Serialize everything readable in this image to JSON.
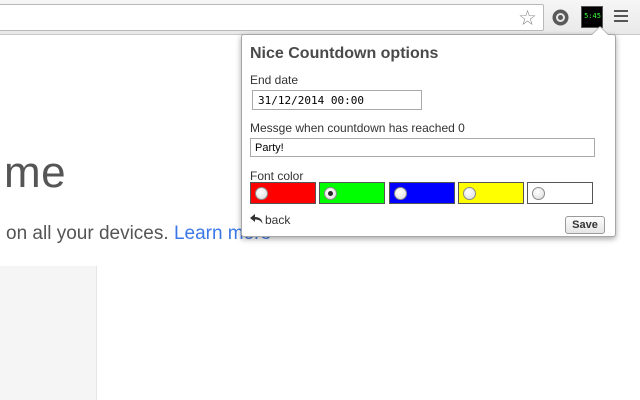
{
  "browser": {
    "omnibox_value": "",
    "icons": [
      "star-icon",
      "extension-icon",
      "countdown-extension-icon",
      "menu-icon"
    ],
    "countdown_badge": "5:45"
  },
  "page": {
    "heading": "me",
    "line_text": "on all your devices.",
    "link_text": "Learn more"
  },
  "popup": {
    "title": "Nice Countdown options",
    "end_date_label": "End date",
    "end_date_value": "31/12/2014 00:00",
    "message_label": "Messge when countdown has reached 0",
    "message_value": "Party!",
    "font_color_label": "Font color",
    "font_colors": [
      {
        "color": "#ff0000",
        "selected": false
      },
      {
        "color": "#00ff00",
        "selected": true
      },
      {
        "color": "#0000ff",
        "selected": false
      },
      {
        "color": "#ffff00",
        "selected": false
      },
      {
        "color": "#ffffff",
        "selected": false
      }
    ],
    "back_label": "back",
    "save_label": "Save"
  }
}
